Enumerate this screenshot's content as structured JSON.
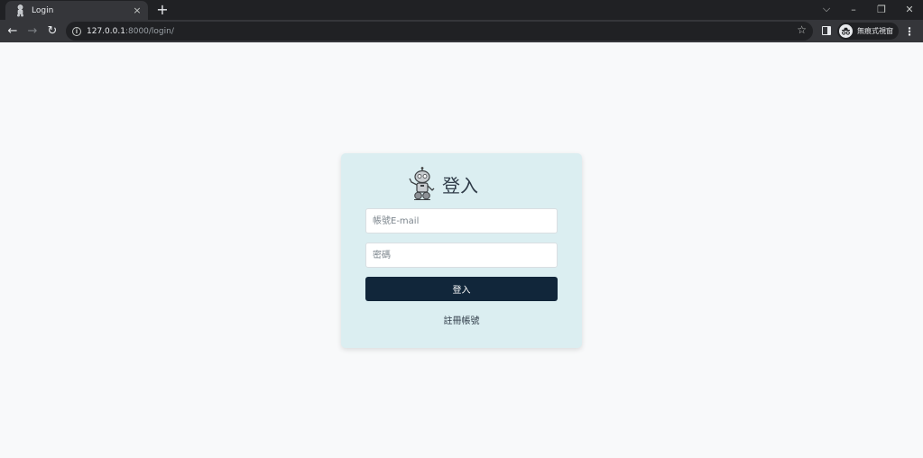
{
  "browser": {
    "tab_title": "Login",
    "tab_close": "×",
    "new_tab": "+",
    "url_host": "127.0.0.1",
    "url_path": ":8000/login/",
    "incognito_label": "無痕式視窗",
    "window_controls": {
      "dropdown": "⌵",
      "minimize": "–",
      "restore": "❐",
      "close": "✕"
    },
    "nav": {
      "back": "←",
      "forward": "→",
      "reload": "↻"
    },
    "bookmark_star": "☆",
    "menu": "⋮"
  },
  "login": {
    "title": "登入",
    "email_placeholder": "帳號E-mail",
    "password_placeholder": "密碼",
    "submit_label": "登入",
    "register_link": "註冊帳號"
  },
  "colors": {
    "card_bg": "#dbeef1",
    "button_bg": "#11263a",
    "page_bg": "#f8f9fa"
  }
}
